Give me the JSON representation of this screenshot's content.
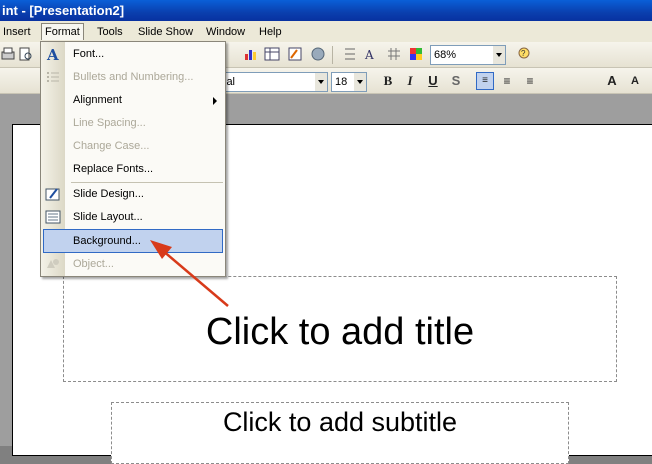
{
  "window": {
    "title": "int - [Presentation2]"
  },
  "menubar": {
    "items": [
      "Insert",
      "Format",
      "Tools",
      "Slide Show",
      "Window",
      "Help"
    ]
  },
  "toolbar": {
    "zoom": "68%",
    "font_name": "ial",
    "font_size": "18"
  },
  "format_menu": {
    "items": [
      {
        "label": "Font...",
        "icon": "font-a-icon",
        "enabled": true
      },
      {
        "label": "Bullets and Numbering...",
        "icon": "bullets-icon",
        "enabled": false
      },
      {
        "label": "Alignment",
        "enabled": true,
        "submenu": true
      },
      {
        "label": "Line Spacing...",
        "enabled": false
      },
      {
        "label": "Change Case...",
        "enabled": false
      },
      {
        "label": "Replace Fonts...",
        "enabled": true
      },
      {
        "label": "Slide Design...",
        "icon": "slide-design-icon",
        "enabled": true
      },
      {
        "label": "Slide Layout...",
        "icon": "slide-layout-icon",
        "enabled": true
      },
      {
        "label": "Background...",
        "enabled": true,
        "highlighted": true
      },
      {
        "label": "Object...",
        "icon": "object-icon",
        "enabled": false
      }
    ]
  },
  "slide": {
    "title_placeholder": "Click to add title",
    "subtitle_placeholder": "Click to add subtitle"
  },
  "colors": {
    "annotation_arrow": "#d83a1a",
    "menu_highlight": "#c1d2ee",
    "titlebar": "#0a4fc8"
  }
}
